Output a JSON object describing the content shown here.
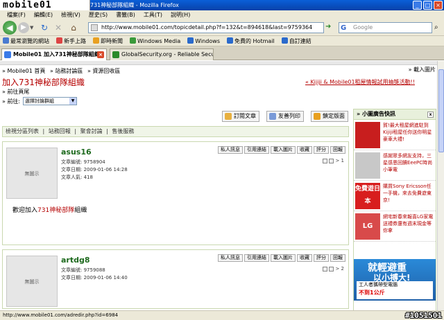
{
  "window": {
    "logo_text": "mobile01",
    "title": "731神秘部隊組織 - Mozilla Firefox",
    "min": "_",
    "max": "□",
    "close": "×"
  },
  "menu": [
    "檔案(F)",
    "編輯(E)",
    "檢視(V)",
    "歷史(S)",
    "書籤(B)",
    "工具(T)",
    "說明(H)"
  ],
  "nav": {
    "url": "http://www.mobile01.com/topicdetail.php?f=132&t=894618&last=9759364",
    "search_placeholder": "Google",
    "search_brand": "G"
  },
  "bookmarks": [
    {
      "label": "最常瀏覽的網站",
      "color": "#4a7bd0"
    },
    {
      "label": "新手上路",
      "color": "#d44"
    },
    {
      "label": "即時新聞",
      "color": "#e8a020"
    },
    {
      "label": "Windows Media",
      "color": "#3a9a3a"
    },
    {
      "label": "Windows",
      "color": "#2a6acc"
    },
    {
      "label": "免費的 Hotmail",
      "color": "#2a6acc"
    },
    {
      "label": "自訂連結",
      "color": "#2a6acc"
    }
  ],
  "tabs": [
    {
      "label": "Mobile01 加入731神秘部隊組織",
      "active": true
    },
    {
      "label": "GlobalSecurity.org - Reliable Security I...",
      "active": false
    }
  ],
  "page": {
    "breadcrumbs": [
      "» Mobile01 首頁",
      "» 站務討論區",
      "» 資源回收區"
    ],
    "download_pics": "» 載入圖片",
    "topic_title": "加入731神秘部隊組織",
    "promo": "« Kijiji & Mobile01租屋情報試用抽獎活動!!",
    "prev_page": "» 前往頁尾",
    "goto_label": "» 前往:",
    "forum_select": "選擇討論群組",
    "actions": {
      "subscribe": "訂閱文章",
      "print": "友善列印",
      "lock": "鎖定版面"
    },
    "tabs_row": [
      "檢視分區列表",
      "|",
      "站務回報",
      "|",
      "聚會討論",
      "|",
      "售後服務"
    ],
    "post_buttons": [
      "私人訊息",
      "引用連結",
      "載入圖片",
      "收藏",
      "評分",
      "回報"
    ],
    "avatar_text": "無圖示",
    "posts": [
      {
        "username": "asus16",
        "id_label": "文章編號: 9758904",
        "date_label": "文章日期: 2009-01-06 14:28",
        "popularity": "文章人氣: 418",
        "pager": "> 1",
        "body_prefix": "歡迎加入",
        "body_highlight": "731神秘部隊",
        "body_suffix": "組織"
      },
      {
        "username": "artdg8",
        "id_label": "文章編號: 9759088",
        "date_label": "文章日期: 2009-01-06 14:40",
        "pager": "> 2"
      }
    ]
  },
  "side": {
    "head": "» 小圖廣告快訊",
    "close": "x",
    "ads": [
      {
        "text": "賀!最大租屋網進駐到Kijiji租屋任你送你明星豪車大禮!",
        "color": "#c81e1e"
      },
      {
        "text": "感謝眾多網友支持，三星感恩回饋EeePC時尚小筆電",
        "color": "#c8c8c8"
      },
      {
        "text": "購買Sony Ericsson任一手機，來去免費遊東京!",
        "color": "#d81e1e",
        "img_label": "免費遊日本"
      },
      {
        "text": "網宅新春來報喜LG家電送禮券還有週末現金等你拿",
        "color": "#d84a4a",
        "img_label": "LG"
      }
    ],
    "big_ad": {
      "line1": "就輕避重",
      "line2": "以小搏大!",
      "line3": "工人者攜帶型電腦",
      "line4": "不到1公斤"
    }
  },
  "status": {
    "text": "http://www.mobile01.com/adredir.php?id=6984",
    "watermark": "#1051501"
  }
}
